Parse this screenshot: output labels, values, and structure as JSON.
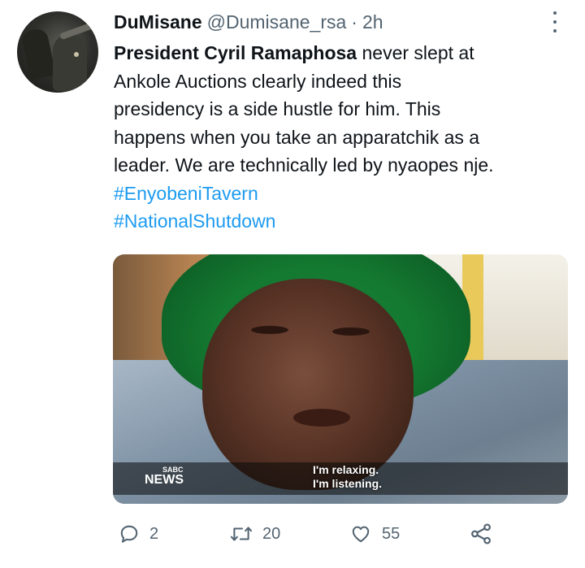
{
  "tweet": {
    "display_name": "DuMisane",
    "handle": "@Dumisane_rsa",
    "separator": "·",
    "time": "2h",
    "text_lines": [
      {
        "mention": "President Cyril Ramaphosa",
        "rest": " never slept at"
      },
      "Ankole Auctions clearly indeed this",
      "presidency is a side hustle for him. This",
      "happens when you take an apparatchik as a",
      "leader. We are technically led by nyaopes nje."
    ],
    "hashtags": [
      "#EnyobeniTavern",
      "#NationalShutdown"
    ]
  },
  "media": {
    "logo_top": "SABC",
    "logo_main": "NEWS",
    "caption_line1": "I'm relaxing.",
    "caption_line2": "I'm listening."
  },
  "actions": {
    "reply_count": "2",
    "retweet_count": "20",
    "like_count": "55"
  },
  "icons": {
    "more": "more-vertical-icon",
    "reply": "comment-icon",
    "retweet": "retweet-icon",
    "like": "heart-icon",
    "share": "share-icon"
  },
  "colors": {
    "text": "#0f1419",
    "secondary": "#536471",
    "link": "#1d9bf0"
  }
}
